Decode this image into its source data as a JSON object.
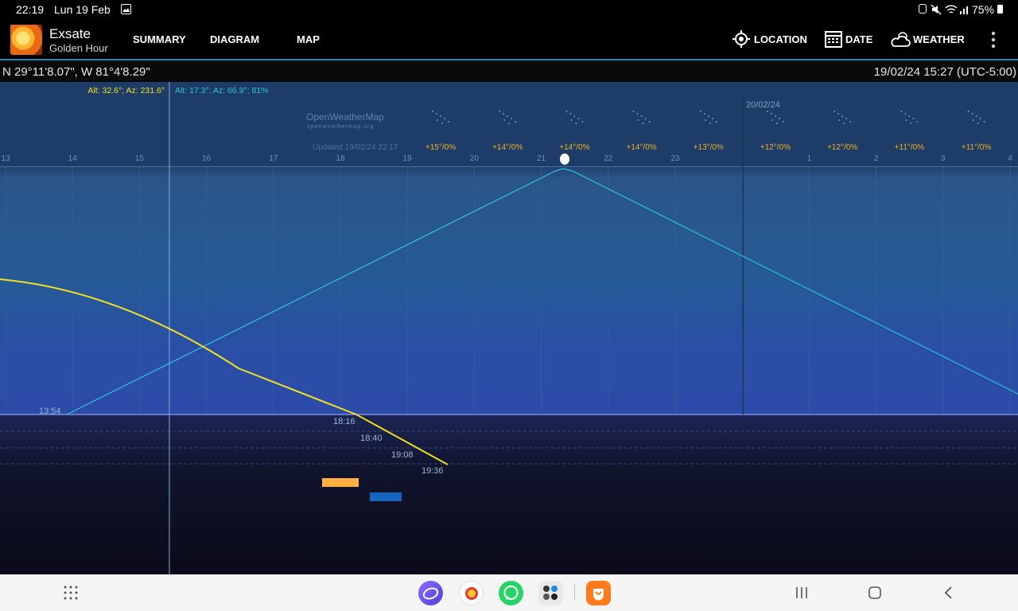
{
  "status_bar": {
    "time": "22:19",
    "date": "Lun 19 Feb",
    "battery": "75%"
  },
  "app": {
    "name": "Exsate",
    "subtitle": "Golden Hour"
  },
  "tabs": [
    {
      "label": "SUMMARY",
      "active": false
    },
    {
      "label": "DIAGRAM",
      "active": true
    },
    {
      "label": "MAP",
      "active": false
    }
  ],
  "actions": {
    "location": "LOCATION",
    "date": "DATE",
    "weather": "WEATHER"
  },
  "info": {
    "coordinates": "N 29°11'8.07\", W 81°4'8.29\"",
    "datetime": "19/02/24 15:27 (UTC-5:00)"
  },
  "diagram": {
    "sun_readout": "Alt: 32.6°; Az: 231.6°",
    "moon_readout": "Alt: 17.3°; Az: 66.9°; 81%",
    "next_day_label": "20/02/24",
    "owm_title": "OpenWeatherMap",
    "owm_url": "openweathermap.org",
    "owm_updated": "Updated 19/02/24 22:17",
    "hour_labels": [
      "13",
      "14",
      "15",
      "16",
      "17",
      "18",
      "19",
      "20",
      "21",
      "22",
      "23",
      "",
      "1",
      "2",
      "3",
      "4"
    ],
    "forecasts": [
      "+15°/0%",
      "+14°/0%",
      "+14°/0%",
      "+14°/0%",
      "+13°/0%",
      "+12°/0%",
      "+12°/0%",
      "+11°/0%",
      "+11°/0%"
    ],
    "moonrise_time": "13:54",
    "sun_times": [
      "18:16",
      "18:40",
      "19:08",
      "19:36"
    ],
    "colors": {
      "sun_curve": "#f0e020",
      "moon_curve": "#2ec4d6",
      "golden_hour": "#ffb040",
      "blue_hour": "#1565c0",
      "sky_top": "#2a5588",
      "sky_horizon": "#2c4aa8",
      "night": "#0a0a18"
    }
  },
  "dock": {
    "icons": [
      "apps-grid-icon",
      "samsung-internet-icon",
      "app-icon-2",
      "whatsapp-icon",
      "app-folder-icon",
      "app-icon-5"
    ]
  }
}
